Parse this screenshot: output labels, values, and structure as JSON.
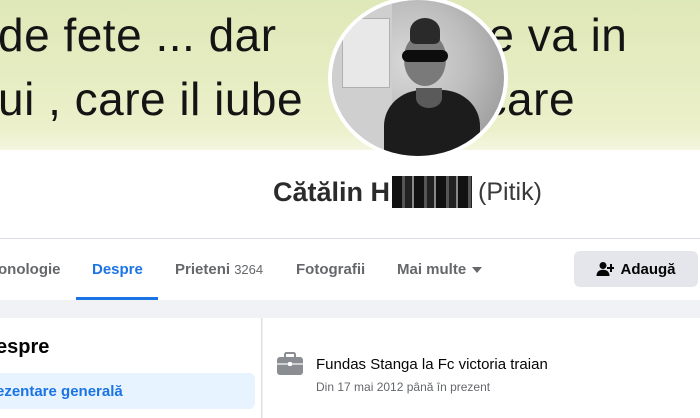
{
  "cover": {
    "line1": "de fete ... dar ",
    "line1_tail": "se va in",
    "line2": "ui , care il iube",
    "line2_tail": "pe care"
  },
  "profile": {
    "name_prefix": "Cătălin H",
    "nickname": "(Pitik)"
  },
  "tabs": [
    {
      "label": "onologie"
    },
    {
      "label": "Despre",
      "active": true
    },
    {
      "label": "Prieteni",
      "count": "3264"
    },
    {
      "label": "Fotografii"
    },
    {
      "label": "Mai multe"
    }
  ],
  "actions": {
    "add_label": "Adaugă"
  },
  "about": {
    "title": "espre",
    "menu_item": "ezentare generală"
  },
  "work": {
    "title": "Fundas Stanga la Fc victoria traian",
    "date": "Din 17 mai 2012 până în prezent"
  },
  "colors": {
    "accent": "#1b74e4",
    "button_bg": "#e4e6eb",
    "muted": "#65676b"
  }
}
